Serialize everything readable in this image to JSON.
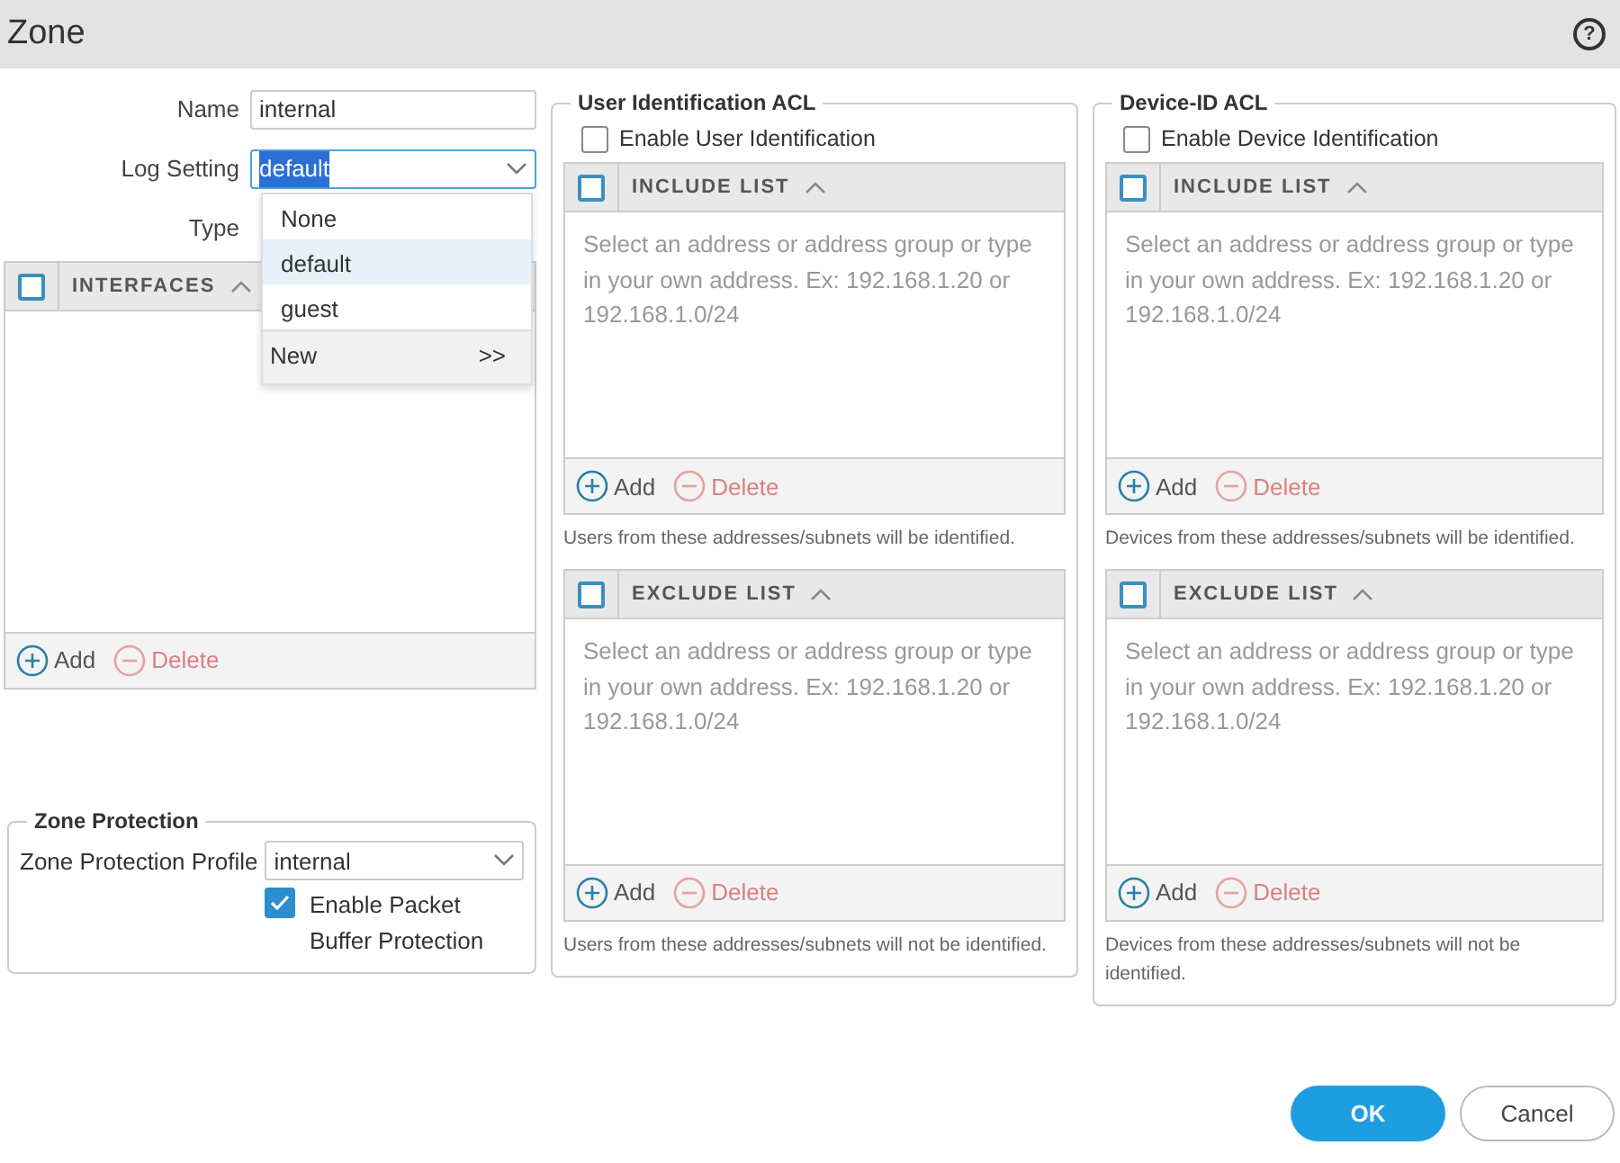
{
  "window": {
    "title": "Zone",
    "help": "?"
  },
  "general": {
    "fields": [
      {
        "label": "Name",
        "kind": "text",
        "value": "internal",
        "focused": false,
        "highlighted": false
      },
      {
        "label": "Log Setting",
        "kind": "select",
        "value": "default",
        "focused": true,
        "highlighted": true
      },
      {
        "label": "Type",
        "kind": "label"
      }
    ]
  },
  "log_setting_dropdown": {
    "options": [
      {
        "label": "None",
        "selected": false
      },
      {
        "label": "default",
        "selected": true
      },
      {
        "label": "guest",
        "selected": false
      }
    ],
    "footer": {
      "label": "New",
      "arrow": ">>"
    }
  },
  "interfaces": {
    "header": "INTERFACES",
    "checked": false,
    "actions": [
      {
        "label": "Add",
        "kind": "add",
        "disabled": false
      },
      {
        "label": "Delete",
        "kind": "delete",
        "disabled": true
      }
    ]
  },
  "zone_protection": {
    "legend": "Zone Protection",
    "profile_label": "Zone Protection Profile",
    "profile_value": "internal",
    "packet_buffer": {
      "label": "Enable Packet Buffer Protection",
      "checked": true
    }
  },
  "acls": [
    {
      "legend": "User Identification ACL",
      "enable": {
        "label": "Enable User Identification",
        "checked": false
      },
      "lists": [
        {
          "header": "INCLUDE LIST",
          "checked": false,
          "empty_text": "Select an address or address group or type in your own address. Ex: 192.168.1.20 or 192.168.1.0/24",
          "actions": [
            {
              "label": "Add",
              "kind": "add",
              "disabled": false
            },
            {
              "label": "Delete",
              "kind": "delete",
              "disabled": true
            }
          ],
          "note": "Users from these addresses/subnets will be identified."
        },
        {
          "header": "EXCLUDE LIST",
          "checked": false,
          "empty_text": "Select an address or address group or type in your own address. Ex: 192.168.1.20 or 192.168.1.0/24",
          "actions": [
            {
              "label": "Add",
              "kind": "add",
              "disabled": false
            },
            {
              "label": "Delete",
              "kind": "delete",
              "disabled": true
            }
          ],
          "note": "Users from these addresses/subnets will not be identified."
        }
      ]
    },
    {
      "legend": "Device-ID ACL",
      "enable": {
        "label": "Enable Device Identification",
        "checked": false
      },
      "lists": [
        {
          "header": "INCLUDE LIST",
          "checked": false,
          "empty_text": "Select an address or address group or type in your own address. Ex: 192.168.1.20 or 192.168.1.0/24",
          "actions": [
            {
              "label": "Add",
              "kind": "add",
              "disabled": false
            },
            {
              "label": "Delete",
              "kind": "delete",
              "disabled": true
            }
          ],
          "note": "Devices from these addresses/subnets will be identified."
        },
        {
          "header": "EXCLUDE LIST",
          "checked": false,
          "empty_text": "Select an address or address group or type in your own address. Ex: 192.168.1.20 or 192.168.1.0/24",
          "actions": [
            {
              "label": "Add",
              "kind": "add",
              "disabled": false
            },
            {
              "label": "Delete",
              "kind": "delete",
              "disabled": true
            }
          ],
          "note": "Devices from these addresses/subnets will not be identified."
        }
      ]
    }
  ],
  "buttons": [
    {
      "label": "OK",
      "kind": "primary"
    },
    {
      "label": "Cancel",
      "kind": "secondary"
    }
  ]
}
